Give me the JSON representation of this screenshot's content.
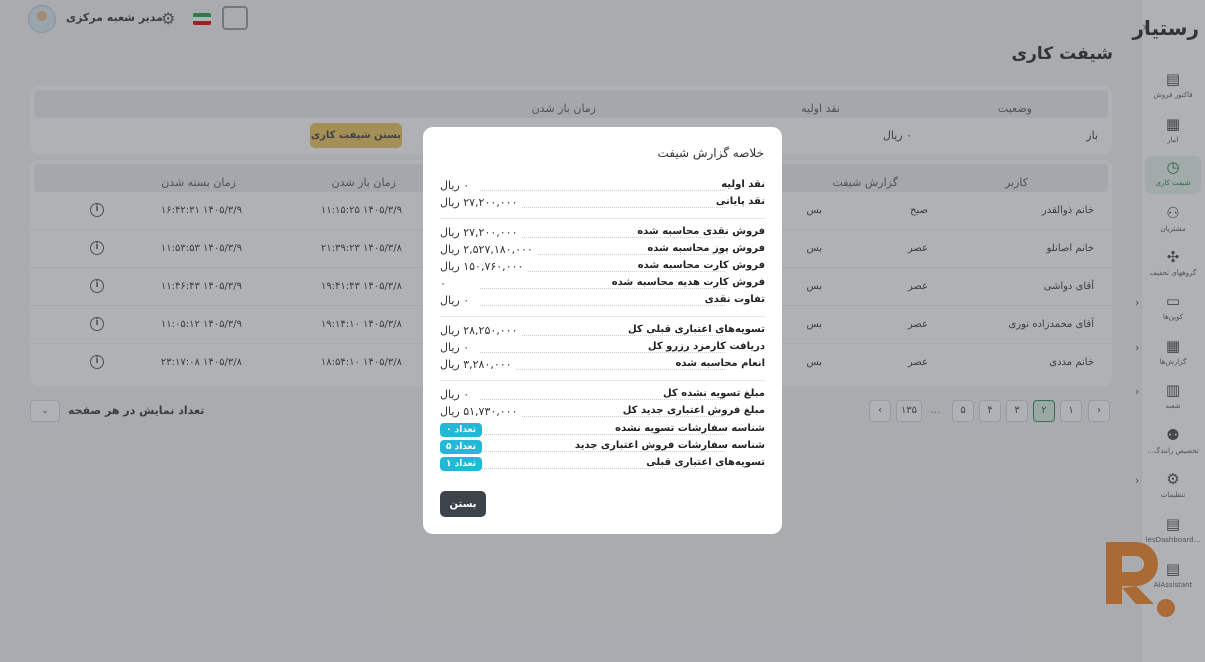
{
  "app": {
    "logo": "رستیار",
    "page_title": "شیفت کاری"
  },
  "topbar": {
    "user_name": "مدیر شعبه مرکزی"
  },
  "sidebar": {
    "items": [
      {
        "label": "فاکتور فروش",
        "icon": "receipt-icon",
        "glyph": "🧾"
      },
      {
        "label": "انبار",
        "icon": "warehouse-icon",
        "glyph": "▤"
      },
      {
        "label": "شیفت کاری",
        "icon": "clock-icon",
        "glyph": "◷"
      },
      {
        "label": "مشتریان",
        "icon": "users-icon",
        "glyph": "👥"
      },
      {
        "label": "گروههای تخفیف",
        "icon": "group-icon",
        "glyph": "✣"
      },
      {
        "label": "کوپن‌ها",
        "icon": "coupon-icon",
        "glyph": "▭"
      },
      {
        "label": "گزارش‌ها",
        "icon": "report-icon",
        "glyph": "▦"
      },
      {
        "label": "شعبه",
        "icon": "store-icon",
        "glyph": "▥"
      },
      {
        "label": "تخصیص رانندگ...",
        "icon": "driver-icon",
        "glyph": "⚇"
      },
      {
        "label": "تنظیمات",
        "icon": "settings-icon",
        "glyph": "⚙"
      },
      {
        "label": "...lesDashboard",
        "icon": "dashboard-icon",
        "glyph": "▤"
      },
      {
        "label": "AiAssistant",
        "icon": "assistant-icon",
        "glyph": "▤"
      }
    ]
  },
  "shift": {
    "headers": {
      "status": "وضعیت",
      "initial_cash": "نقد اولیه",
      "open_time": "زمان باز شدن"
    },
    "status": "باز",
    "initial_cash": "۰ ریال",
    "close_button": "بستن شیفت کاری"
  },
  "history": {
    "headers": {
      "user": "کاربر",
      "shift_report": "گزارش شیفت",
      "open_time": "زمان باز شدن",
      "close_time": "زمان بسته شدن"
    },
    "rows": [
      {
        "user": "خانم ذوالقدر",
        "shift": "صبح",
        "partial": "بس",
        "open": "۱۴۰۵/۳/۹ ۱۱:۱۵:۲۵",
        "close": "۱۴۰۵/۳/۹ ۱۶:۴۲:۳۱"
      },
      {
        "user": "خانم اصانلو",
        "shift": "عصر",
        "partial": "بس",
        "open": "۱۴۰۵/۳/۸ ۲۱:۳۹:۲۳",
        "close": "۱۴۰۵/۳/۹ ۱۱:۵۳:۵۳"
      },
      {
        "user": "آقای دواشی",
        "shift": "عصر",
        "partial": "بس",
        "open": "۱۴۰۵/۳/۸ ۱۹:۴۱:۴۳",
        "close": "۱۴۰۵/۳/۹ ۱۱:۴۶:۴۳"
      },
      {
        "user": "آقای محمدزاده نوری",
        "shift": "عصر",
        "partial": "بس",
        "open": "۱۴۰۵/۳/۸ ۱۹:۱۴:۱۰",
        "close": "۱۴۰۵/۳/۹ ۱۱:۰۵:۱۲"
      },
      {
        "user": "خانم مددی",
        "shift": "عصر",
        "partial": "بس",
        "open": "۱۴۰۵/۳/۸ ۱۸:۵۴:۱۰",
        "close": "۱۴۰۵/۳/۸ ۲۳:۱۷:۰۸"
      }
    ]
  },
  "pagination": {
    "pages": [
      "۱",
      "۲",
      "۳",
      "۴",
      "۵"
    ],
    "active": "۲",
    "ellipsis": "...",
    "last": "۱۳۵",
    "per_page_label": "تعداد نمایش در هر صفحه"
  },
  "modal": {
    "title": "خلاصه گزارش شیفت",
    "rows": [
      {
        "label": "نقد اولیه",
        "value": "۰ ریال"
      },
      {
        "label": "نقد پایانی",
        "value": "۲۷,۲۰۰,۰۰۰ ریال"
      },
      {
        "label": "فروش نقدی محاسبه شده",
        "value": "۲۷,۲۰۰,۰۰۰ ریال"
      },
      {
        "label": "فروش پوز محاسبه شده",
        "value": "۲,۵۲۷,۱۸۰,۰۰۰ ریال"
      },
      {
        "label": "فروش کارت محاسبه شده",
        "value": "۱۵۰,۷۶۰,۰۰۰ ریال"
      },
      {
        "label": "فروش کارت هدیه محاسبه شده",
        "value": "۰"
      },
      {
        "label": "تفاوت نقدی",
        "value": "۰ ریال"
      },
      {
        "label": "تسویه‌های اعتباری قبلی کل",
        "value": "۲۸,۲۵۰,۰۰۰ ریال"
      },
      {
        "label": "دریافت کارمزد رزرو کل",
        "value": "۰ ریال"
      },
      {
        "label": "انعام محاسبه شده",
        "value": "۳,۲۸۰,۰۰۰ ریال"
      },
      {
        "label": "مبلغ تسویه نشده کل",
        "value": "۰ ریال"
      },
      {
        "label": "مبلغ فروش اعتباری جدید کل",
        "value": "۵۱,۷۳۰,۰۰۰ ریال"
      }
    ],
    "badges": [
      {
        "label": "شناسه سفارشات تسویه نشده",
        "value": "تعداد ۰"
      },
      {
        "label": "شناسه سفارشات فروش اعتباری جدید",
        "value": "تعداد ۵"
      },
      {
        "label": "تسویه‌های اعتباری قبلی",
        "value": "تعداد ۱"
      }
    ],
    "close_label": "بستن"
  },
  "colors": {
    "accent_green": "#1c7a45",
    "close_shift_yellow": "#ecc65b",
    "badge_cyan": "#22b8d6",
    "brand_orange": "#f58220"
  }
}
